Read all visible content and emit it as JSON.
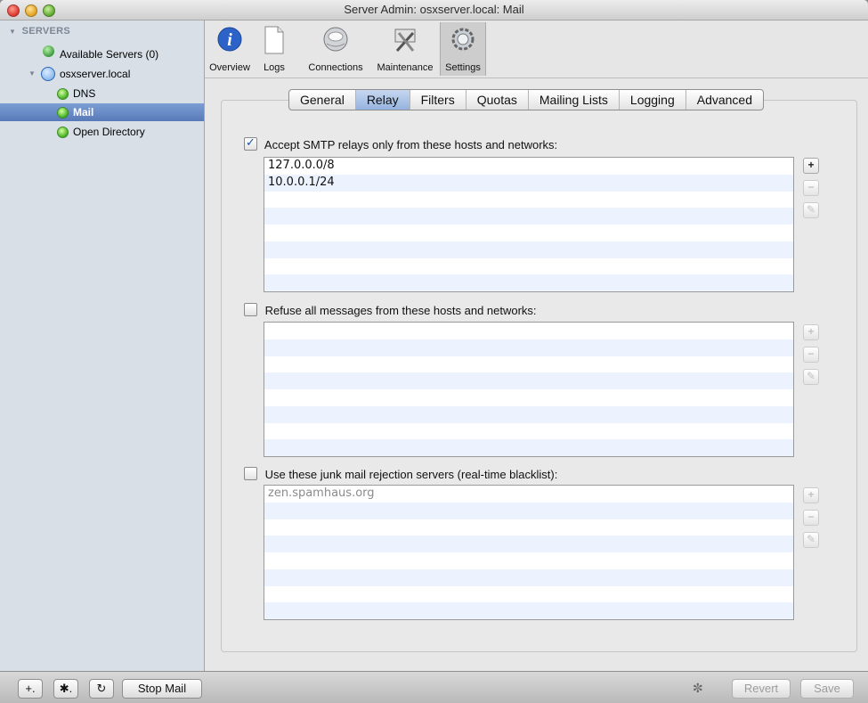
{
  "window": {
    "title": "Server Admin: osxserver.local: Mail"
  },
  "sidebar": {
    "header": "SERVERS",
    "items": [
      {
        "label": "Available Servers (0)"
      },
      {
        "label": "osxserver.local"
      },
      {
        "label": "DNS"
      },
      {
        "label": "Mail"
      },
      {
        "label": "Open Directory"
      }
    ]
  },
  "toolbar": {
    "buttons": [
      {
        "label": "Overview",
        "icon": "info-icon"
      },
      {
        "label": "Logs",
        "icon": "document-icon"
      },
      {
        "label": "Connections",
        "icon": "globe-icon"
      },
      {
        "label": "Maintenance",
        "icon": "tools-icon"
      },
      {
        "label": "Settings",
        "icon": "gear-icon"
      }
    ],
    "active": "Settings"
  },
  "tabs": {
    "items": [
      "General",
      "Relay",
      "Filters",
      "Quotas",
      "Mailing Lists",
      "Logging",
      "Advanced"
    ],
    "active": "Relay"
  },
  "sections": [
    {
      "label": "Accept SMTP relays only from these hosts and networks:",
      "checked": true,
      "rows": [
        "127.0.0.0/8",
        "10.0.0.1/24"
      ],
      "buttons_enabled": {
        "add": true,
        "remove": false,
        "edit": false
      }
    },
    {
      "label": "Refuse all messages from these hosts and networks:",
      "checked": false,
      "rows": [],
      "buttons_enabled": {
        "add": false,
        "remove": false,
        "edit": false
      }
    },
    {
      "label": "Use these junk mail rejection servers (real-time blacklist):",
      "checked": false,
      "rows": [
        "zen.spamhaus.org"
      ],
      "buttons_enabled": {
        "add": false,
        "remove": false,
        "edit": false
      }
    }
  ],
  "bottombar": {
    "add_label": "+.",
    "action_label": "✱.",
    "refresh_label": "↻",
    "stop_label": "Stop Mail",
    "revert_label": "Revert",
    "save_label": "Save"
  },
  "colors": {
    "selection": "#5779b8",
    "stripe": "#edf3fe",
    "status_green": "#43b027"
  }
}
